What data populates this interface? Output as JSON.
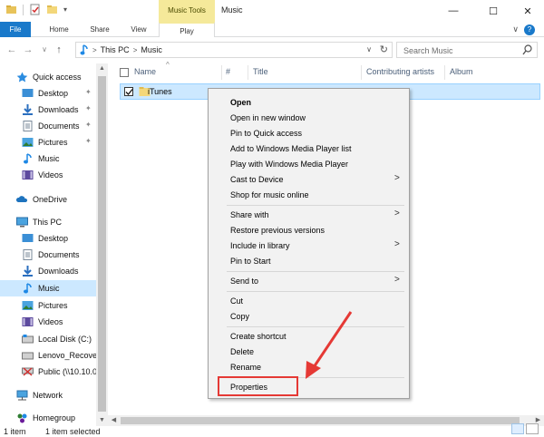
{
  "window": {
    "title": "Music",
    "context_tab": "Music Tools"
  },
  "controls": {
    "minimize": "—",
    "maximize": "☐",
    "close": "✕"
  },
  "ribbon": {
    "tabs": [
      "File",
      "Home",
      "Share",
      "View",
      "Play"
    ],
    "help": "?",
    "collapse": "∨"
  },
  "address": {
    "segments": [
      "This PC",
      "Music"
    ],
    "separator": ">",
    "dropdown": "∨",
    "refresh": "↻"
  },
  "nav_buttons": {
    "back": "←",
    "forward": "→",
    "recent": "∨",
    "up": "↑"
  },
  "search": {
    "placeholder": "Search Music"
  },
  "nav": {
    "items": [
      {
        "label": "Quick access",
        "icon": "star-icon"
      },
      {
        "label": "Desktop",
        "icon": "desktop-icon"
      },
      {
        "label": "Downloads",
        "icon": "download-icon"
      },
      {
        "label": "Documents",
        "icon": "documents-icon"
      },
      {
        "label": "Pictures",
        "icon": "pictures-icon"
      },
      {
        "label": "Music",
        "icon": "music-icon"
      },
      {
        "label": "Videos",
        "icon": "videos-icon"
      },
      {
        "label": "OneDrive",
        "icon": "cloud-icon"
      },
      {
        "label": "This PC",
        "icon": "computer-icon"
      },
      {
        "label": "Desktop",
        "icon": "desktop-icon"
      },
      {
        "label": "Documents",
        "icon": "documents-icon"
      },
      {
        "label": "Downloads",
        "icon": "download-icon"
      },
      {
        "label": "Music",
        "icon": "music-icon"
      },
      {
        "label": "Pictures",
        "icon": "pictures-icon"
      },
      {
        "label": "Videos",
        "icon": "videos-icon"
      },
      {
        "label": "Local Disk (C:)",
        "icon": "drive-icon"
      },
      {
        "label": "Lenovo_Recover",
        "icon": "drive-icon"
      },
      {
        "label": "Public (\\\\10.10.0",
        "icon": "network-drive-icon"
      },
      {
        "label": "Network",
        "icon": "network-icon"
      },
      {
        "label": "Homegroup",
        "icon": "homegroup-icon"
      }
    ],
    "pin_glyph": "📌"
  },
  "columns": [
    "Name",
    "#",
    "Title",
    "Contributing artists",
    "Album"
  ],
  "files": [
    {
      "name": "iTunes"
    }
  ],
  "menu": {
    "items": [
      "Open",
      "Open in new window",
      "Pin to Quick access",
      "Add to Windows Media Player list",
      "Play with Windows Media Player",
      "Cast to Device",
      "Shop for music online",
      "Share with",
      "Restore previous versions",
      "Include in library",
      "Pin to Start",
      "Send to",
      "Cut",
      "Copy",
      "Create shortcut",
      "Delete",
      "Rename",
      "Properties"
    ],
    "submenu_glyph": ">"
  },
  "status": {
    "count": "1 item",
    "selected": "1 item selected"
  },
  "colors": {
    "accent": "#1979ca",
    "selection": "#cce8ff",
    "highlight": "#e53935",
    "context": "#f5e99a"
  }
}
